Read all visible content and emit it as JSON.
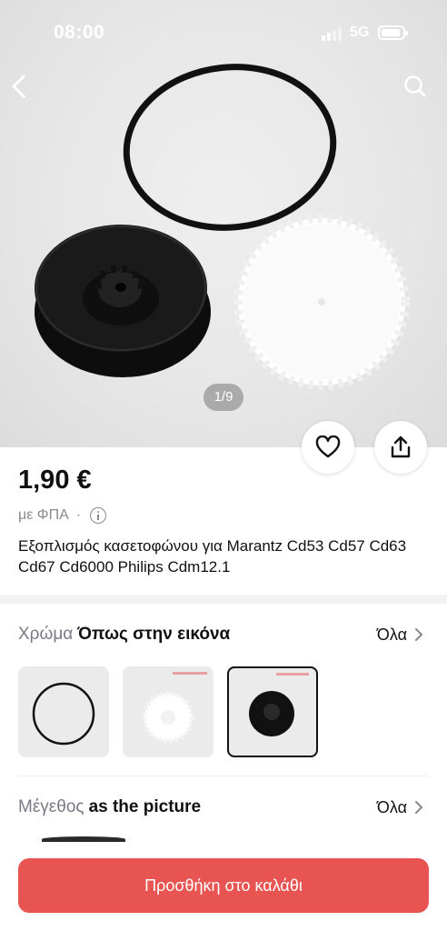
{
  "status_bar": {
    "time": "08:00",
    "network": "5G"
  },
  "gallery": {
    "page_indicator": "1/9"
  },
  "product": {
    "price": "1,90 €",
    "vat_note": "με ΦΠΑ",
    "vat_separator": "·",
    "title": "Εξοπλισμός κασετοφώνου για Marantz Cd53 Cd57 Cd63 Cd67 Cd6000 Philips Cdm12.1"
  },
  "color_option": {
    "label": "Χρώμα",
    "value": "Όπως στην εικόνα",
    "all_label": "Όλα"
  },
  "size_option": {
    "label": "Μέγεθος",
    "value": "as the picture",
    "all_label": "Όλα"
  },
  "cta": {
    "label": "Προσθήκη στο καλάθι"
  },
  "colors": {
    "accent": "#e75451",
    "muted_label": "#7a7a86"
  },
  "icons": {
    "back": "chevron-left-icon",
    "search": "search-icon",
    "like": "heart-icon",
    "share": "share-icon",
    "info": "info-icon",
    "more": "chevron-right-icon"
  }
}
